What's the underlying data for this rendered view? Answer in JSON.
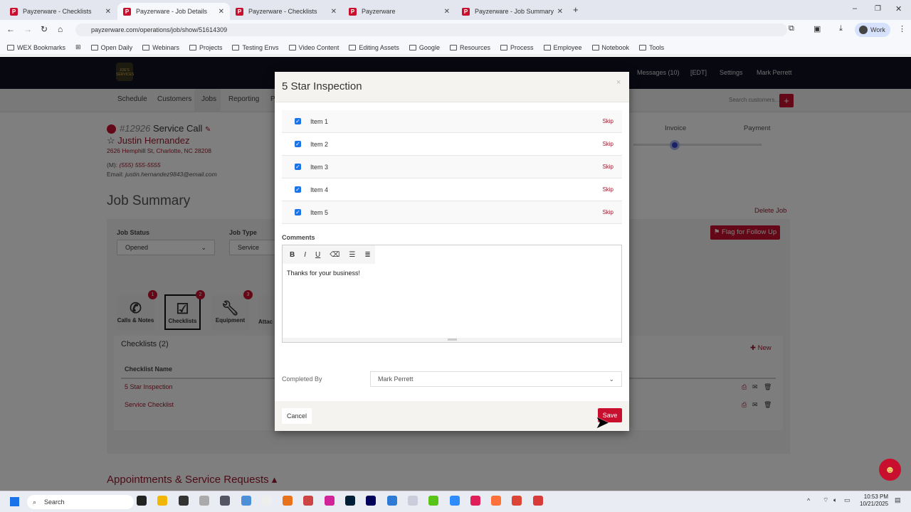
{
  "browser": {
    "tabs": [
      {
        "title": "Payzerware - Checklists",
        "active": false
      },
      {
        "title": "Payzerware - Job Details",
        "active": true
      },
      {
        "title": "Payzerware - Checklists",
        "active": false
      },
      {
        "title": "Payzerware",
        "active": false
      },
      {
        "title": "Payzerware - Job Summary",
        "active": false
      }
    ],
    "url": "payzerware.com/operations/job/show/51614309",
    "profile": "Work",
    "bookmarks": [
      "WEX Bookmarks",
      "Open Daily",
      "Webinars",
      "Projects",
      "Testing Envs",
      "Video Content",
      "Editing Assets",
      "Google",
      "Resources",
      "Process",
      "Employee",
      "Notebook",
      "Tools"
    ]
  },
  "app": {
    "logo_text": "JOE'S SERVICES",
    "header": {
      "messages": "Messages (10)",
      "timezone": "[EDT]",
      "settings": "Settings",
      "user": "Mark Perrett"
    },
    "nav": [
      "Schedule",
      "Customers",
      "Jobs",
      "Reporting",
      "P"
    ],
    "search_placeholder": "Search customers...",
    "job": {
      "number": "#12926",
      "type_label": "Service Call",
      "customer": "Justin Hernandez",
      "address": "2626 Hemphill St, Charlotte, NC 28208",
      "phone_label": "(M):",
      "phone": "(555) 555-5555",
      "email_label": "Email:",
      "email": "justin.hernandez9843@email.com"
    },
    "progress": {
      "steps": [
        "Invoice",
        "Payment"
      ],
      "current": "Invoice"
    },
    "summary_title": "Job Summary",
    "delete_job": "Delete Job",
    "flag_button": "Flag for Follow Up",
    "job_status": {
      "label": "Job Status",
      "value": "Opened"
    },
    "job_type": {
      "label": "Job Type",
      "value": "Service"
    },
    "tiles": [
      {
        "label": "Calls & Notes",
        "badge": "1"
      },
      {
        "label": "Checklists",
        "badge": "2"
      },
      {
        "label": "Equipment",
        "badge": "3"
      },
      {
        "label": "Attac"
      }
    ],
    "checklists": {
      "title": "Checklists (2)",
      "new": "New",
      "column": "Checklist Name",
      "rows": [
        "5 Star Inspection",
        "Service Checklist"
      ]
    },
    "appointments": "Appointments & Service Requests"
  },
  "modal": {
    "title": "5 Star Inspection",
    "close": "×",
    "items": [
      {
        "label": "Item 1",
        "checked": true,
        "skip": "Skip"
      },
      {
        "label": "Item 2",
        "checked": true,
        "skip": "Skip"
      },
      {
        "label": "Item 3",
        "checked": true,
        "skip": "Skip"
      },
      {
        "label": "Item 4",
        "checked": true,
        "skip": "Skip"
      },
      {
        "label": "Item 5",
        "checked": true,
        "skip": "Skip"
      }
    ],
    "comments_label": "Comments",
    "toolbar": [
      "B",
      "I",
      "U",
      "⌫",
      "☰",
      "≣"
    ],
    "comment_text": "Thanks for your business!",
    "completed_by_label": "Completed By",
    "completed_by": "Mark Perrett",
    "cancel": "Cancel",
    "save": "Save"
  },
  "taskbar": {
    "search": "Search",
    "time": "10:53 PM",
    "date": "10/21/2025"
  },
  "colors": {
    "brand": "#c8102e",
    "link": "#9b1b30",
    "check": "#1a73e8"
  }
}
